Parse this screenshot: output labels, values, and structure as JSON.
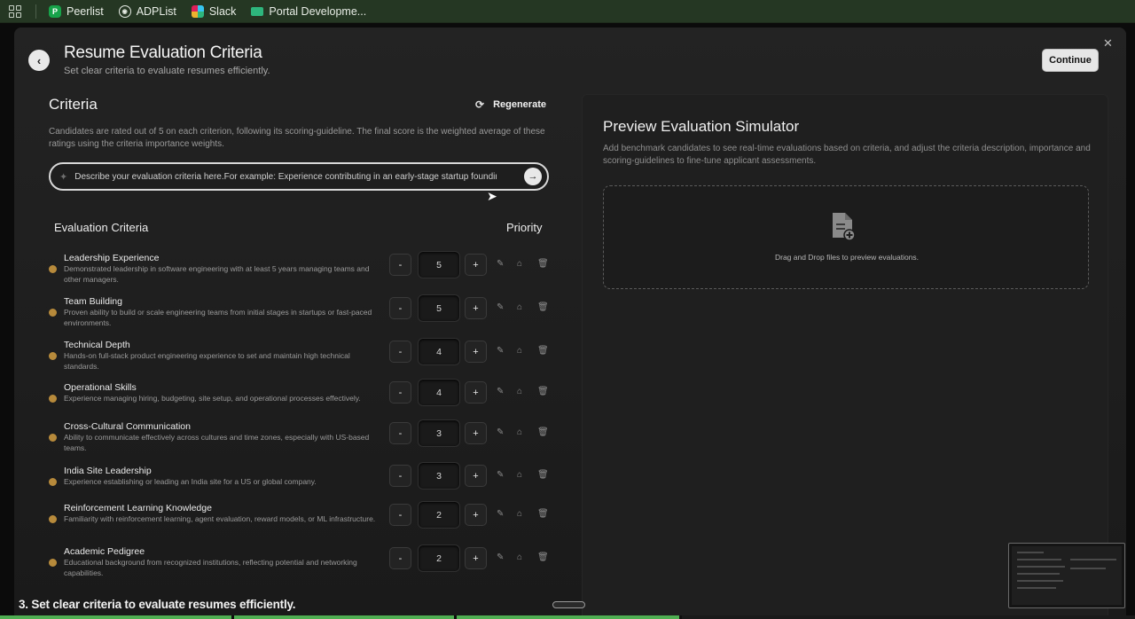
{
  "bookmarks": [
    {
      "label": "Peerlist",
      "icon": "peerlist-icon"
    },
    {
      "label": "ADPList",
      "icon": "adplist-icon"
    },
    {
      "label": "Slack",
      "icon": "slack-icon"
    },
    {
      "label": "Portal Developme...",
      "icon": "portal-icon"
    }
  ],
  "modal": {
    "title": "Resume Evaluation Criteria",
    "subtitle": "Set clear criteria to evaluate resumes efficiently.",
    "continue_label": "Continue",
    "close_label": "✕",
    "back_label": "‹"
  },
  "criteria": {
    "heading": "Criteria",
    "regenerate_label": "Regenerate",
    "description": "Candidates are rated out of 5 on each criterion, following its scoring-guideline. The final score is the weighted average of these ratings using the criteria importance weights.",
    "prompt_placeholder": "Describe your evaluation criteria here.For example: Experience contributing in an early-stage startup founding team",
    "eval_heading": "Evaluation Criteria",
    "priority_heading": "Priority",
    "items": [
      {
        "name": "Leadership Experience",
        "text": "Demonstrated leadership in software engineering with at least 5 years managing teams and other managers.",
        "priority": "5"
      },
      {
        "name": "Team Building",
        "text": "Proven ability to build or scale engineering teams from initial stages in startups or fast-paced environments.",
        "priority": "5"
      },
      {
        "name": "Technical Depth",
        "text": "Hands-on full-stack product engineering experience to set and maintain high technical standards.",
        "priority": "4"
      },
      {
        "name": "Operational Skills",
        "text": "Experience managing hiring, budgeting, site setup, and operational processes effectively.",
        "priority": "4"
      },
      {
        "name": "Cross-Cultural Communication",
        "text": "Ability to communicate effectively across cultures and time zones, especially with US-based teams.",
        "priority": "3"
      },
      {
        "name": "India Site Leadership",
        "text": "Experience establishing or leading an India site for a US or global company.",
        "priority": "3"
      },
      {
        "name": "Reinforcement Learning Knowledge",
        "text": "Familiarity with reinforcement learning, agent evaluation, reward models, or ML infrastructure.",
        "priority": "2"
      },
      {
        "name": "Academic Pedigree",
        "text": "Educational background from recognized institutions, reflecting potential and networking capabilities.",
        "priority": "2"
      }
    ]
  },
  "preview": {
    "title": "Preview Evaluation Simulator",
    "description": "Add benchmark candidates to see real-time evaluations based on criteria, and adjust the criteria description, importance and scoring-guidelines to fine-tune applicant assessments.",
    "drop_text": "Drag and Drop files to preview evaluations."
  },
  "caption": "3. Set clear criteria to evaluate resumes efficiently.",
  "progress_fraction": 0.6,
  "colors": {
    "accent_dot": "#b78a3b",
    "progress": "#4fae52",
    "bookmarks_bar": "#253723"
  }
}
